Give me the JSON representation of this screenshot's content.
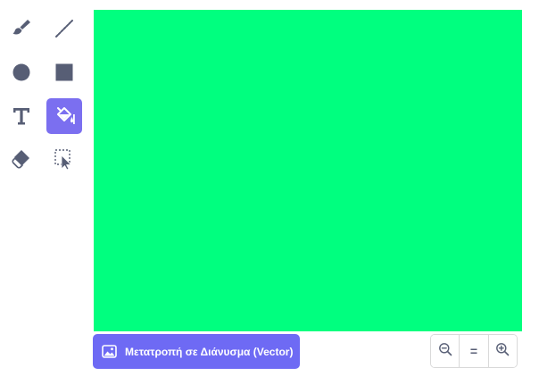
{
  "toolbar": {
    "tools": [
      {
        "name": "brush",
        "icon": "brush-icon",
        "selected": false
      },
      {
        "name": "line",
        "icon": "line-icon",
        "selected": false
      },
      {
        "name": "circle",
        "icon": "circle-icon",
        "selected": false
      },
      {
        "name": "rectangle",
        "icon": "rectangle-icon",
        "selected": false
      },
      {
        "name": "text",
        "icon": "text-icon",
        "selected": false
      },
      {
        "name": "fill",
        "icon": "fill-bucket-icon",
        "selected": true
      },
      {
        "name": "eraser",
        "icon": "eraser-icon",
        "selected": false
      },
      {
        "name": "select",
        "icon": "select-icon",
        "selected": false
      }
    ]
  },
  "canvas": {
    "fill_color": "#00ff7f"
  },
  "convert_button": {
    "label": "Μετατροπή σε Διάνυσμα (Vector)",
    "icon": "image-icon"
  },
  "zoom": {
    "zoom_out_icon": "zoom-out-icon",
    "reset_label": "=",
    "zoom_in_icon": "zoom-in-icon"
  },
  "colors": {
    "icon": "#575e75",
    "accent": "#7b6ff0",
    "convert_button": "#6e6af4",
    "canvas_fill": "#00ff7f"
  }
}
